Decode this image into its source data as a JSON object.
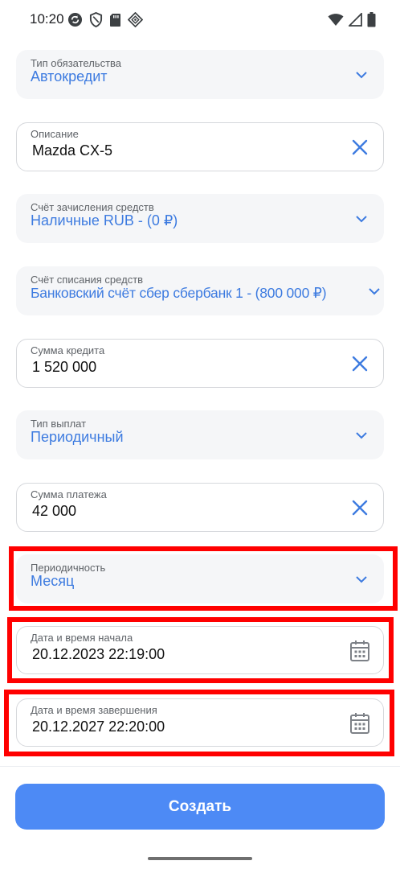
{
  "status_bar": {
    "time": "10:20",
    "left_icons": [
      "sync-icon",
      "shield-icon",
      "sd-card-icon",
      "diamond-app-icon"
    ],
    "right_icons": [
      "wifi-icon",
      "signal-icon",
      "battery-icon"
    ]
  },
  "form": {
    "obligation_type": {
      "label": "Тип обязательства",
      "value": "Автокредит"
    },
    "description": {
      "label": "Описание",
      "value": "Mazda CX-5"
    },
    "credit_account": {
      "label": "Счёт зачисления средств",
      "value": "Наличные RUB - (0 ₽)"
    },
    "debit_account": {
      "label": "Счёт списания средств",
      "value": "Банковский счёт сбер сбербанк 1 - (800 000 ₽)"
    },
    "credit_amount": {
      "label": "Сумма кредита",
      "value": "1 520 000"
    },
    "payment_type": {
      "label": "Тип выплат",
      "value": "Периодичный"
    },
    "payment_amount": {
      "label": "Сумма платежа",
      "value": "42 000"
    },
    "periodicity": {
      "label": "Периодичность",
      "value": "Месяц"
    },
    "start_datetime": {
      "label": "Дата и время начала",
      "value": "20.12.2023 22:19:00"
    },
    "end_datetime": {
      "label": "Дата и время завершения",
      "value": "20.12.2027 22:20:00"
    }
  },
  "footer": {
    "create_label": "Создать"
  },
  "colors": {
    "accent": "#4d8af5",
    "value_blue": "#3d7be0",
    "highlight": "#ff0000",
    "select_bg": "#f5f6f8"
  }
}
